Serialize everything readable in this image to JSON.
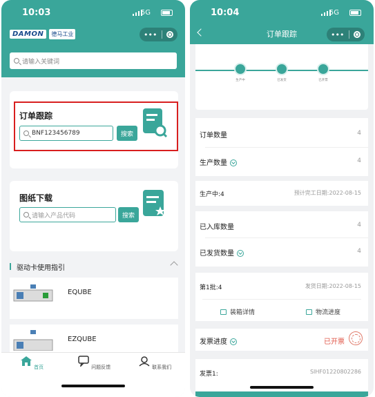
{
  "left": {
    "status": {
      "time": "10:03",
      "network": "5G"
    },
    "logo": {
      "brand": "DAMON",
      "sub": "德马工业"
    },
    "search": {
      "placeholder": "请输入关键词"
    },
    "order_card": {
      "title": "订单跟踪",
      "input_value": "BNF123456789",
      "button": "搜索"
    },
    "drawing_card": {
      "title": "图纸下载",
      "input_placeholder": "请输入产品代码",
      "button": "搜索"
    },
    "guide": {
      "title": "驱动卡使用指引"
    },
    "products": [
      {
        "name": "EQUBE"
      },
      {
        "name": "EZQUBE"
      }
    ],
    "tabs": [
      {
        "label": "首页"
      },
      {
        "label": "问题反馈"
      },
      {
        "label": "联系我们"
      }
    ]
  },
  "right": {
    "status": {
      "time": "10:04",
      "network": "5G"
    },
    "nav": {
      "title": "订单跟踪"
    },
    "steps": [
      {
        "label": "生产中"
      },
      {
        "label": "已发货"
      },
      {
        "label": "已开票"
      }
    ],
    "rows": {
      "order_qty": {
        "label": "订单数量",
        "value": "4"
      },
      "prod_qty": {
        "label": "生产数量",
        "value": "4"
      },
      "in_prod": {
        "label": "生产中:4",
        "value": "预计完工日期:2022-08-15"
      },
      "stocked": {
        "label": "已入库数量",
        "value": "4"
      },
      "shipped": {
        "label": "已发货数量",
        "value": "4"
      },
      "batch": {
        "label": "第1批:4",
        "value": "发货日期:2022-08-15"
      },
      "packing": {
        "label": "装箱详情"
      },
      "logistics": {
        "label": "物流进度"
      },
      "invoice": {
        "label": "发票进度",
        "value": "已开票"
      },
      "invoice1": {
        "label": "发票1:",
        "value": "SIHF01220802286"
      }
    }
  },
  "colors": {
    "teal": "#3aa69a",
    "highlight": "#d81e1e",
    "invoiced": "#e0584a"
  }
}
